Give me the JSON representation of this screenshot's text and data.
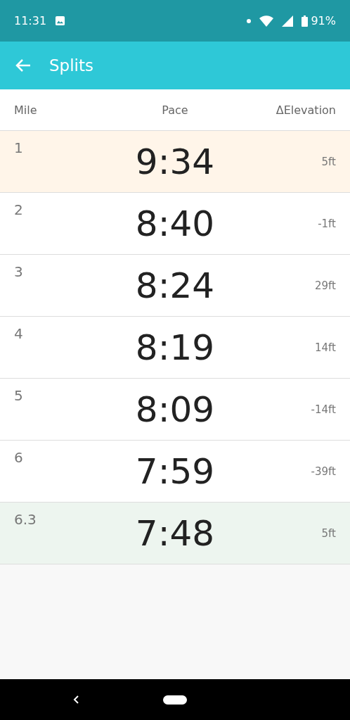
{
  "status_bar": {
    "time": "11:31",
    "battery": "91%"
  },
  "app_bar": {
    "title": "Splits"
  },
  "columns": [
    "Mile",
    "Pace",
    "ΔElevation"
  ],
  "rows": [
    {
      "mile": "1",
      "pace": "9:34",
      "elevation": "5ft",
      "color": "#fff5e9"
    },
    {
      "mile": "2",
      "pace": "8:40",
      "elevation": "-1ft",
      "color": "#ffffff"
    },
    {
      "mile": "3",
      "pace": "8:24",
      "elevation": "29ft",
      "color": "#ffffff"
    },
    {
      "mile": "4",
      "pace": "8:19",
      "elevation": "14ft",
      "color": "#ffffff"
    },
    {
      "mile": "5",
      "pace": "8:09",
      "elevation": "-14ft",
      "color": "#ffffff"
    },
    {
      "mile": "6",
      "pace": "7:59",
      "elevation": "-39ft",
      "color": "#ffffff"
    },
    {
      "mile": "6.3",
      "pace": "7:48",
      "elevation": "5ft",
      "color": "#edf5ef"
    }
  ]
}
